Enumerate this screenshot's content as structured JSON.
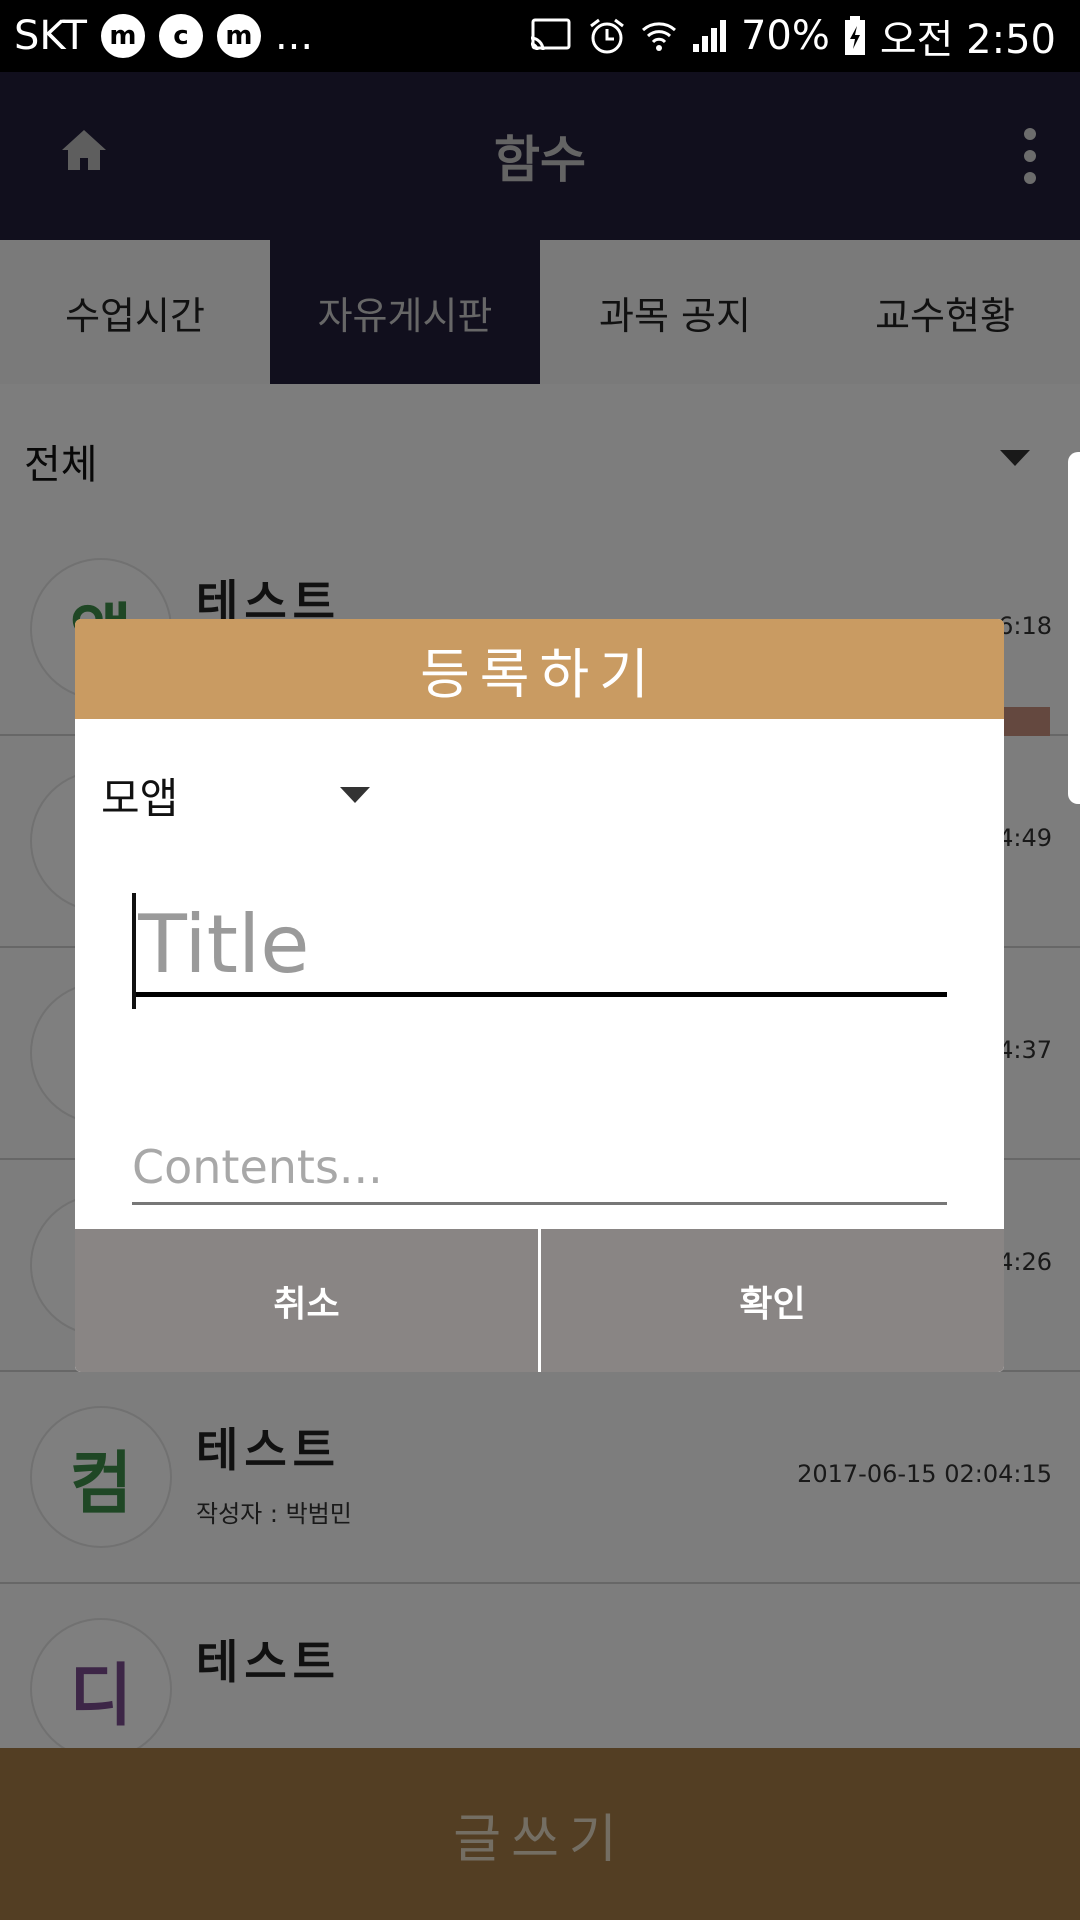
{
  "status_bar": {
    "carrier": "SKT",
    "app_icons": [
      "m",
      "c",
      "m"
    ],
    "more": "...",
    "battery": "70%",
    "time": "오전 2:50",
    "icons": [
      "cast-icon",
      "alarm-icon",
      "wifi-icon",
      "signal-icon",
      "battery-charging-icon"
    ]
  },
  "toolbar": {
    "title": "함수"
  },
  "tabs": [
    "수업시간",
    "자유게시판",
    "과목 공지",
    "교수현황"
  ],
  "active_tab": 1,
  "filter": {
    "label": "전체"
  },
  "posts": [
    {
      "avatar": "앱",
      "avatar_color": "#3f8f4a",
      "title": "테스트",
      "author": "",
      "time": "6:18"
    },
    {
      "avatar": "",
      "avatar_color": "#3f8f4a",
      "title": "",
      "author": "",
      "time": "4:49"
    },
    {
      "avatar": "",
      "avatar_color": "#3f8f4a",
      "title": "",
      "author": "",
      "time": "4:37"
    },
    {
      "avatar": "",
      "avatar_color": "#3f8f4a",
      "title": "",
      "author": "",
      "time": "4:26"
    },
    {
      "avatar": "컴",
      "avatar_color": "#3f8f4a",
      "title": "테스트",
      "author": "작성자 : 박범민",
      "time": "2017-06-15 02:04:15"
    },
    {
      "avatar": "디",
      "avatar_color": "#7a4d8f",
      "title": "테스트",
      "author": "",
      "time": ""
    }
  ],
  "bottom": {
    "write_label": "글쓰기"
  },
  "dialog": {
    "title": "등록하기",
    "category": "모앱",
    "title_placeholder": "Title",
    "content_placeholder": "Contents...",
    "cancel": "취소",
    "confirm": "확인"
  },
  "colors": {
    "toolbar": "#221e3a",
    "dialog_header": "#c99b62",
    "dialog_button": "#898584",
    "write_bar": "#a67c46"
  }
}
